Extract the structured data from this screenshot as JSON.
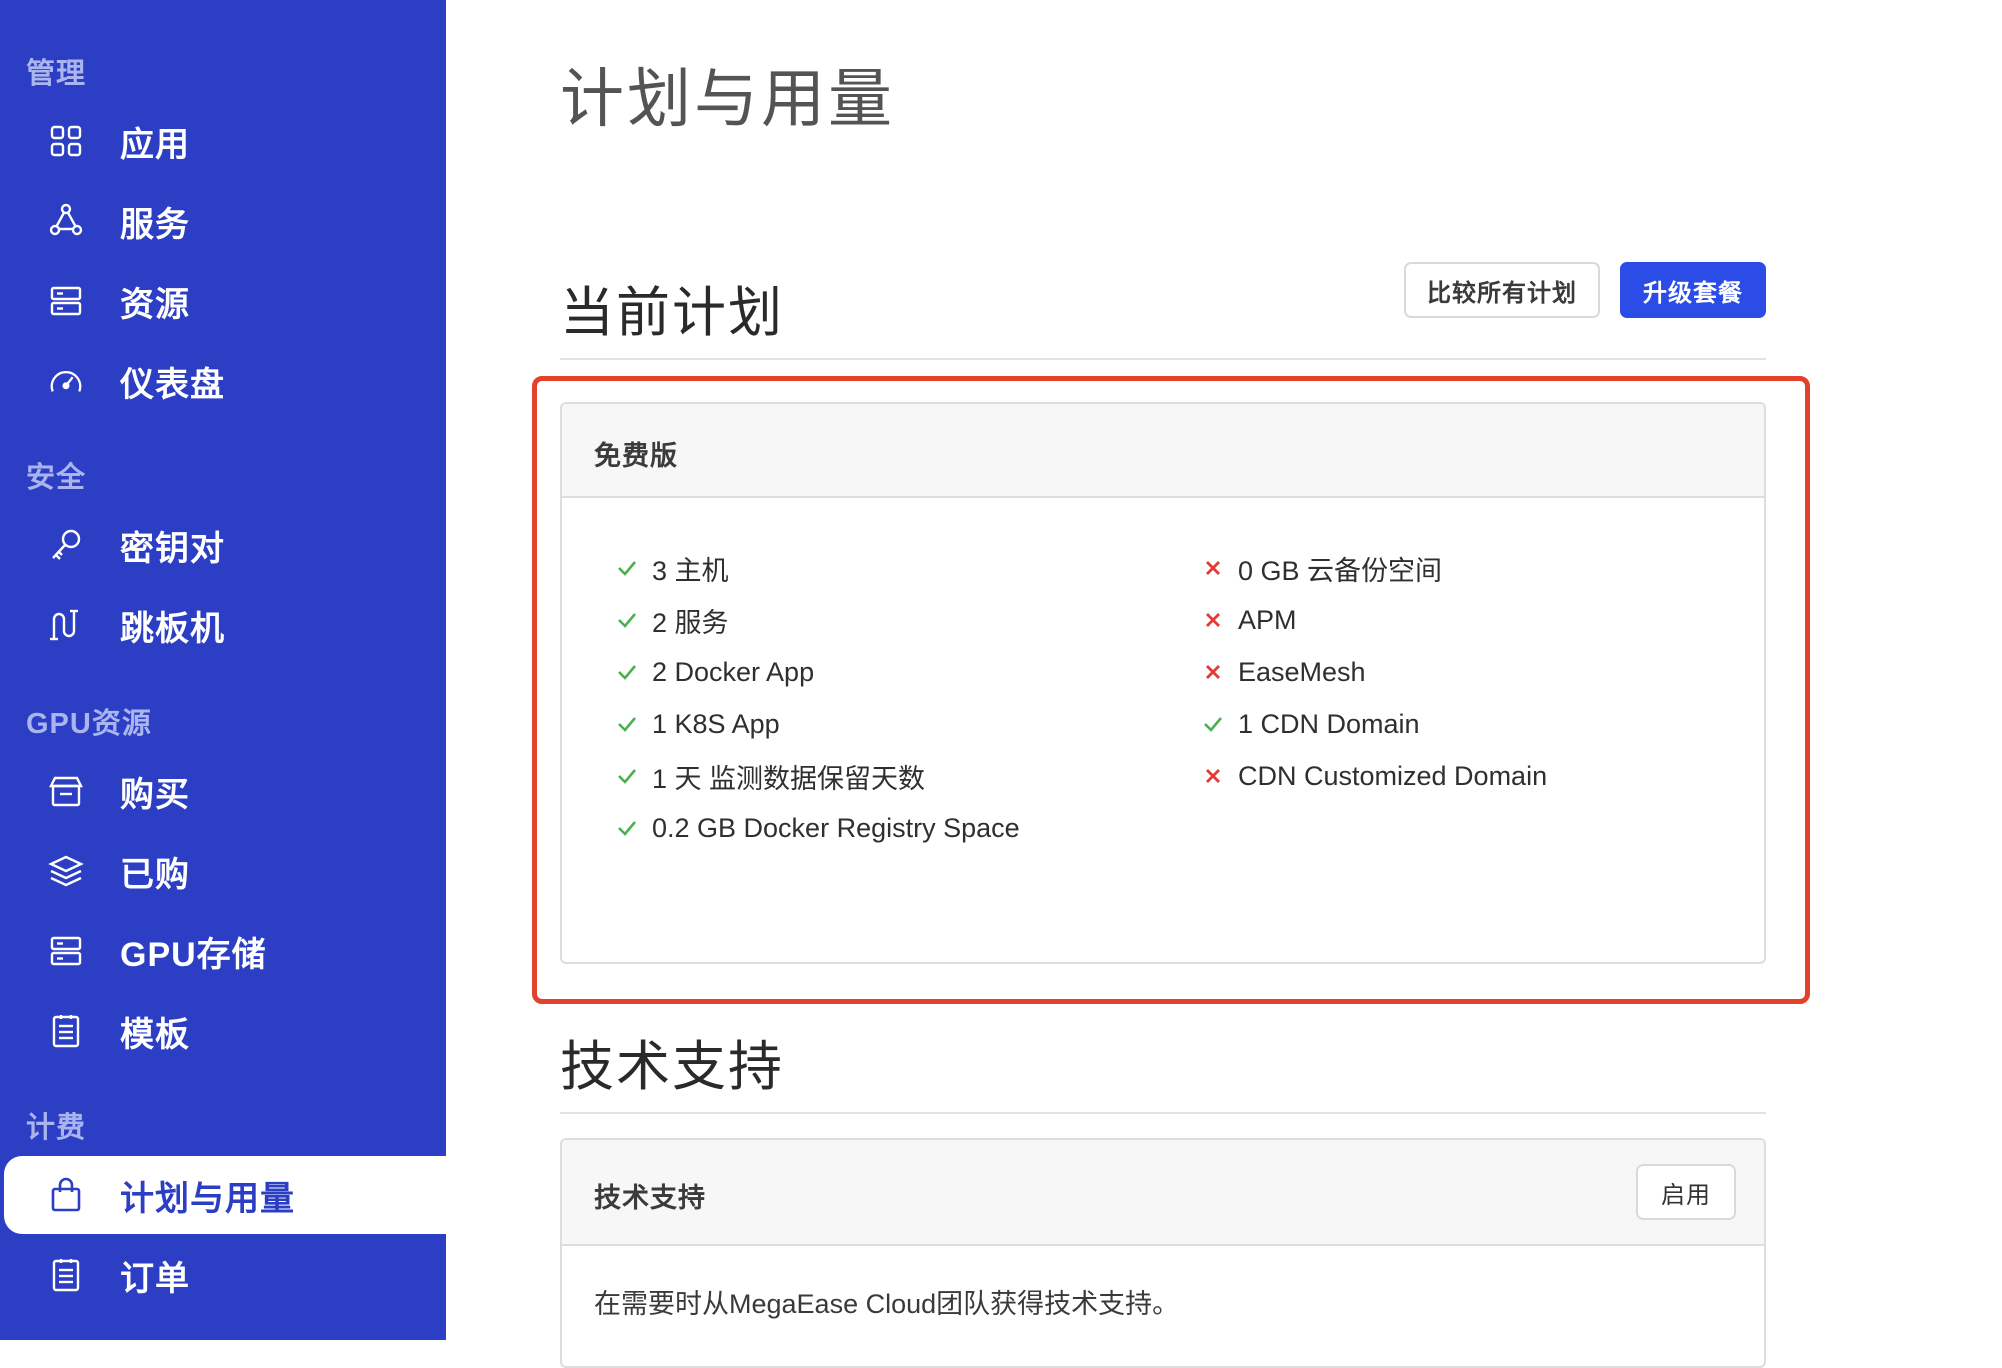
{
  "sidebar": {
    "sections": [
      {
        "title": "管理",
        "items": [
          {
            "label": "应用",
            "icon": "apps-grid-icon"
          },
          {
            "label": "服务",
            "icon": "services-nodes-icon"
          },
          {
            "label": "资源",
            "icon": "server-stack-icon"
          },
          {
            "label": "仪表盘",
            "icon": "gauge-icon"
          }
        ]
      },
      {
        "title": "安全",
        "items": [
          {
            "label": "密钥对",
            "icon": "key-icon"
          },
          {
            "label": "跳板机",
            "icon": "jump-host-icon"
          }
        ]
      },
      {
        "title": "GPU资源",
        "items": [
          {
            "label": "购买",
            "icon": "store-icon"
          },
          {
            "label": "已购",
            "icon": "layers-icon"
          },
          {
            "label": "GPU存储",
            "icon": "server-stack-icon"
          },
          {
            "label": "模板",
            "icon": "document-list-icon"
          }
        ]
      },
      {
        "title": "计费",
        "items": [
          {
            "label": "计划与用量",
            "icon": "shopping-bag-icon",
            "active": true
          },
          {
            "label": "订单",
            "icon": "document-list-icon"
          }
        ]
      }
    ]
  },
  "main": {
    "page_title": "计划与用量",
    "current_plan": {
      "title": "当前计划",
      "compare_button": "比较所有计划",
      "upgrade_button": "升级套餐",
      "plan_name": "免费版",
      "features_left": [
        {
          "text": "3 主机",
          "included": true
        },
        {
          "text": "2 服务",
          "included": true
        },
        {
          "text": "2 Docker App",
          "included": true
        },
        {
          "text": "1 K8S App",
          "included": true
        },
        {
          "text": "1 天 监测数据保留天数",
          "included": true
        },
        {
          "text": "0.2 GB Docker Registry Space",
          "included": true
        }
      ],
      "features_right": [
        {
          "text": "0 GB 云备份空间",
          "included": false
        },
        {
          "text": "APM",
          "included": false
        },
        {
          "text": "EaseMesh",
          "included": false
        },
        {
          "text": "1 CDN Domain",
          "included": true
        },
        {
          "text": "CDN Customized Domain",
          "included": false
        }
      ]
    },
    "support": {
      "title": "技术支持",
      "card_title": "技术支持",
      "enable_button": "启用",
      "description": "在需要时从MegaEase Cloud团队获得技术支持。"
    }
  },
  "colors": {
    "sidebar_bg": "#2b3ec4",
    "primary": "#2b4ce6",
    "check": "#4caf50",
    "cross": "#e53935",
    "highlight": "#e4412d"
  }
}
